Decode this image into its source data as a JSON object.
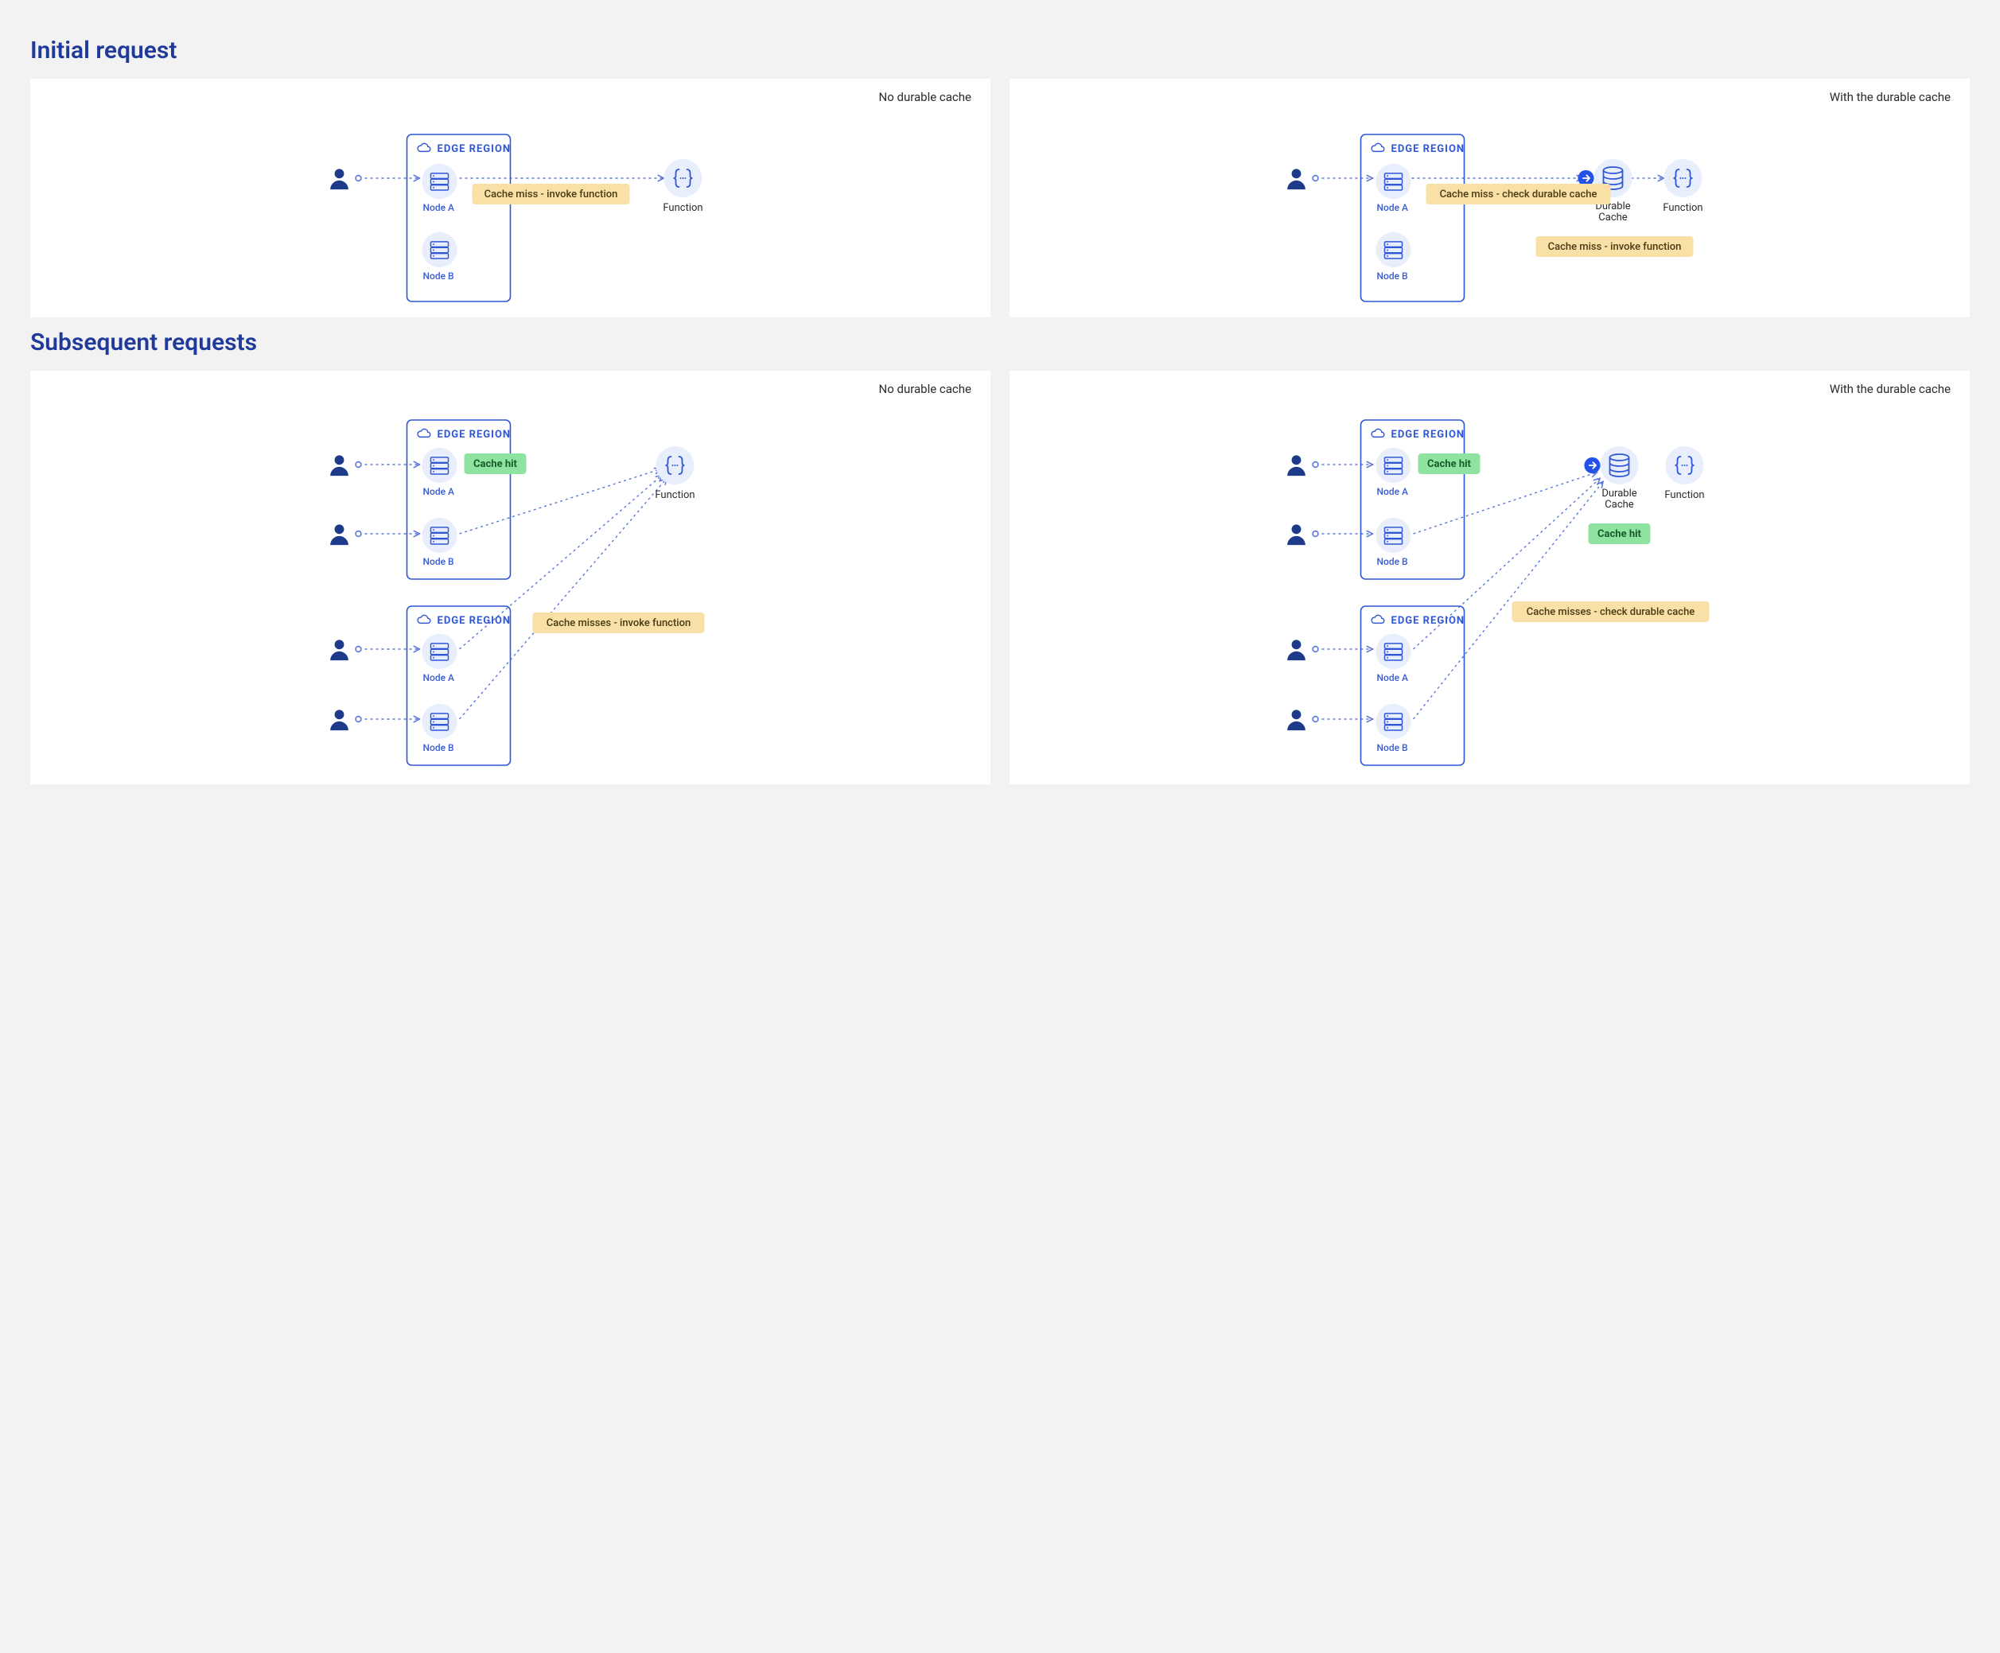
{
  "colors": {
    "primary": "#1e3a8a",
    "stroke": "#2f57d6",
    "icon_bg": "#e8eefc",
    "badge_miss_bg": "#f8e0a6",
    "badge_hit_bg": "#8fe3a1"
  },
  "labels": {
    "edge_region": "EDGE REGION",
    "node_a": "Node A",
    "node_b": "Node B",
    "function": "Function",
    "durable_cache": "Durable\nCache"
  },
  "sections": {
    "initial": {
      "title": "Initial request",
      "left": {
        "title": "No durable cache",
        "badge_miss": "Cache miss - invoke function"
      },
      "right": {
        "title": "With the durable cache",
        "badge_miss_top": "Cache miss - check durable cache",
        "badge_miss_bottom": "Cache miss - invoke function"
      }
    },
    "subsequent": {
      "title": "Subsequent requests",
      "left": {
        "title": "No durable cache",
        "badge_hit": "Cache hit",
        "badge_miss": "Cache misses - invoke function"
      },
      "right": {
        "title": "With the durable cache",
        "badge_hit_node": "Cache hit",
        "badge_hit_cache": "Cache hit",
        "badge_miss": "Cache misses - check durable cache"
      }
    }
  }
}
